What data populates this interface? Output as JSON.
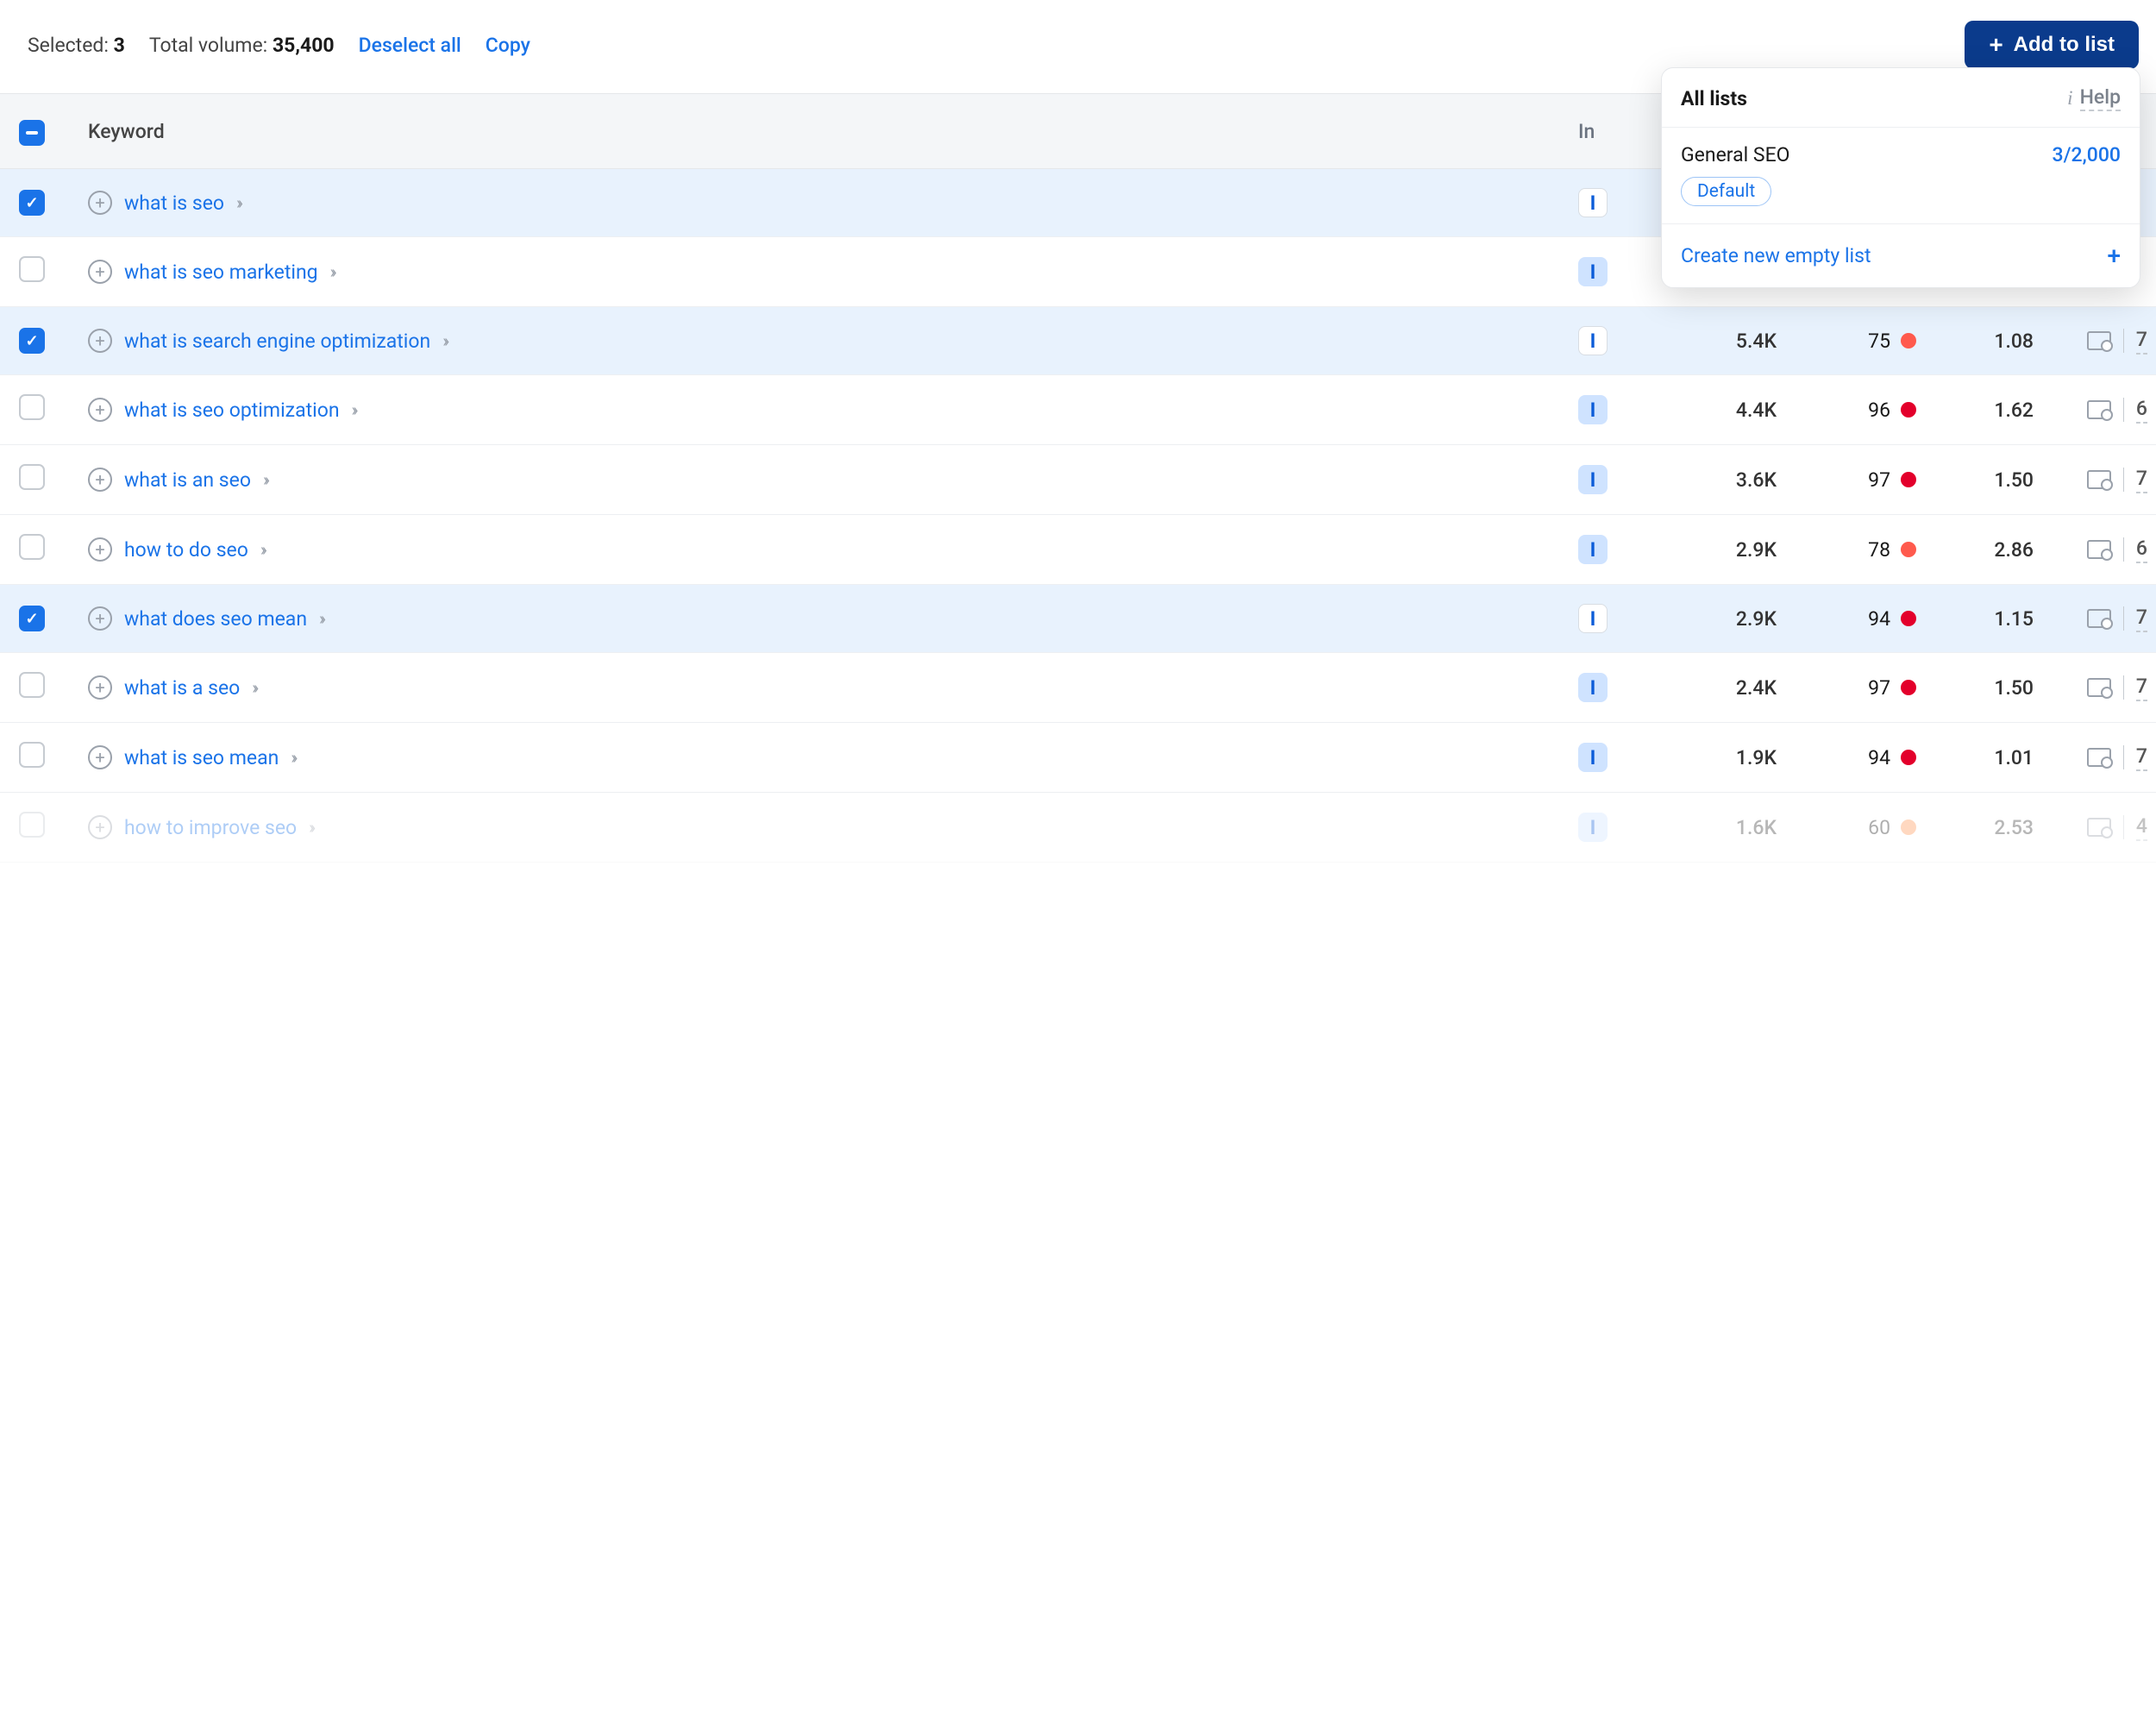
{
  "actionbar": {
    "selected_label": "Selected:",
    "selected_count": "3",
    "total_volume_label": "Total volume:",
    "total_volume": "35,400",
    "deselect_label": "Deselect all",
    "copy_label": "Copy",
    "add_to_list_label": "Add to list"
  },
  "table_header": {
    "keyword": "Keyword",
    "intent": "In"
  },
  "rows": [
    {
      "checked": true,
      "keyword": "what is seo",
      "intent_alt": true,
      "volume": "",
      "kd": "",
      "kd_color": "",
      "cpc": "",
      "serp": ""
    },
    {
      "checked": false,
      "keyword": "what is seo marketing",
      "intent_alt": false,
      "volume": "",
      "kd": "",
      "kd_color": "",
      "cpc": "",
      "serp": ""
    },
    {
      "checked": true,
      "keyword": "what is search engine optimization",
      "intent_alt": true,
      "volume": "5.4K",
      "kd": "75",
      "kd_color": "#ff5a4d",
      "cpc": "1.08",
      "serp": "7"
    },
    {
      "checked": false,
      "keyword": "what is seo optimization",
      "intent_alt": false,
      "volume": "4.4K",
      "kd": "96",
      "kd_color": "#e3002b",
      "cpc": "1.62",
      "serp": "6"
    },
    {
      "checked": false,
      "keyword": "what is an seo",
      "intent_alt": false,
      "volume": "3.6K",
      "kd": "97",
      "kd_color": "#e3002b",
      "cpc": "1.50",
      "serp": "7"
    },
    {
      "checked": false,
      "keyword": "how to do seo",
      "intent_alt": false,
      "volume": "2.9K",
      "kd": "78",
      "kd_color": "#ff5a4d",
      "cpc": "2.86",
      "serp": "6"
    },
    {
      "checked": true,
      "keyword": "what does seo mean",
      "intent_alt": true,
      "volume": "2.9K",
      "kd": "94",
      "kd_color": "#e3002b",
      "cpc": "1.15",
      "serp": "7"
    },
    {
      "checked": false,
      "keyword": "what is a seo",
      "intent_alt": false,
      "volume": "2.4K",
      "kd": "97",
      "kd_color": "#e3002b",
      "cpc": "1.50",
      "serp": "7"
    },
    {
      "checked": false,
      "keyword": "what is seo mean",
      "intent_alt": false,
      "volume": "1.9K",
      "kd": "94",
      "kd_color": "#e3002b",
      "cpc": "1.01",
      "serp": "7"
    },
    {
      "checked": false,
      "keyword": "how to improve seo",
      "intent_alt": false,
      "volume": "1.6K",
      "kd": "60",
      "kd_color": "#ff914d",
      "cpc": "2.53",
      "serp": "4",
      "faded": true
    }
  ],
  "intent_letter": "I",
  "dropdown": {
    "title": "All lists",
    "help": "Help",
    "list_name": "General SEO",
    "list_count": "3/2,000",
    "default_badge": "Default",
    "create_label": "Create new empty list"
  }
}
